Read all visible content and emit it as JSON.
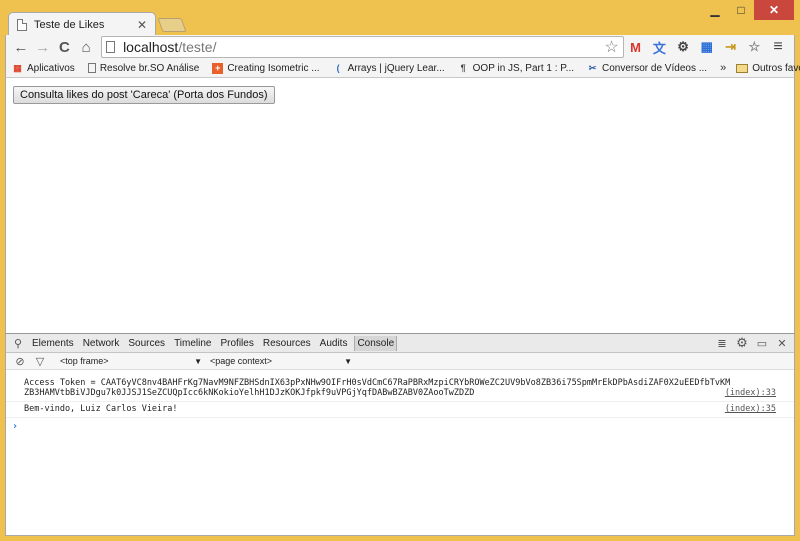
{
  "window": {
    "minimize": "▁",
    "maximize": "□",
    "close": "✕"
  },
  "tab": {
    "title": "Teste de Likes",
    "close": "✕"
  },
  "toolbar": {
    "back": "←",
    "forward": "→",
    "reload": "C",
    "home": "⌂",
    "url_host": "localhost",
    "url_path": "/teste/",
    "star": "☆",
    "menu": "≡"
  },
  "extensions": [
    "M",
    "文",
    "⚙",
    "▦",
    "⇥",
    "☆"
  ],
  "bookmarks": {
    "apps": "Aplicativos",
    "items": [
      {
        "label": "Resolve br.SO Análise"
      },
      {
        "label": "Creating Isometric ..."
      },
      {
        "label": "Arrays | jQuery Lear..."
      },
      {
        "label": "OOP in JS, Part 1 : P..."
      },
      {
        "label": "Conversor de Vídeos ..."
      }
    ],
    "more": "»",
    "other": "Outros favoritos"
  },
  "page": {
    "button_label": "Consulta likes do post 'Careca' (Porta dos Fundos)"
  },
  "devtools": {
    "tabs": [
      "Elements",
      "Network",
      "Sources",
      "Timeline",
      "Profiles",
      "Resources",
      "Audits",
      "Console"
    ],
    "active_tab": "Console",
    "frame_select": "<top frame>",
    "context_select": "<page context>",
    "messages": [
      {
        "text": "Access Token = CAAT6yVC8nv4BAHFrKg7NavM9NFZBHSdnIX63pPxNHw9OIFrH0sVdCmC67RaPBRxMzpiCRYbROWeZC2UV9bVo8ZB36i75SpmMrEkDPbAsdiZAF0X2uEEDfbTvKMZB3HAMVtbBiVJDgu7k0JJSJ1SeZCUQpIcc6kNKokioYelhH1DJzKOKJfpkf9uVPGjYqfDABwBZABV0ZAooTwZDZD",
        "source": "(index):33"
      },
      {
        "text": "Bem-vindo, Luiz Carlos Vieira!",
        "source": "(index):35"
      }
    ],
    "prompt": "›"
  }
}
